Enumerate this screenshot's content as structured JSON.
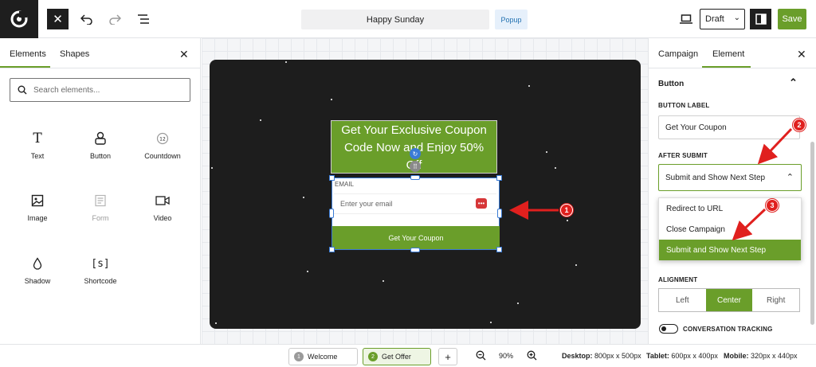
{
  "topbar": {
    "title": "Happy Sunday",
    "badge": "Popup",
    "status": "Draft",
    "save_label": "Save"
  },
  "left_panel": {
    "tabs": [
      "Elements",
      "Shapes"
    ],
    "search_placeholder": "Search elements...",
    "elements": [
      {
        "label": "Text",
        "icon": "text-icon"
      },
      {
        "label": "Button",
        "icon": "button-icon"
      },
      {
        "label": "Countdown",
        "icon": "countdown-icon"
      },
      {
        "label": "Image",
        "icon": "image-icon"
      },
      {
        "label": "Form",
        "icon": "form-icon",
        "disabled": true
      },
      {
        "label": "Video",
        "icon": "video-icon"
      },
      {
        "label": "Shadow",
        "icon": "shadow-icon"
      },
      {
        "label": "Shortcode",
        "icon": "shortcode-icon"
      }
    ]
  },
  "canvas": {
    "heading_line1": "Get Your Exclusive Coupon",
    "heading_line2": "Code Now and Enjoy 50%",
    "heading_line3": "Off",
    "email_label": "EMAIL",
    "email_placeholder": "Enter your email",
    "button_label": "Get Your Coupon"
  },
  "right_panel": {
    "tabs": [
      "Campaign",
      "Element"
    ],
    "section_title": "Button",
    "button_label_title": "BUTTON LABEL",
    "button_label_value": "Get Your Coupon",
    "after_submit_title": "AFTER SUBMIT",
    "after_submit_value": "Submit and Show Next Step",
    "dropdown_options": [
      "Redirect to URL",
      "Close Campaign",
      "Submit and Show Next Step"
    ],
    "dropdown_selected": 2,
    "alignment_title": "ALIGNMENT",
    "alignment_options": [
      "Left",
      "Center",
      "Right"
    ],
    "alignment_selected": "Center",
    "conversion_label": "CONVERSATION TRACKING"
  },
  "bottombar": {
    "steps": [
      {
        "num": "1",
        "label": "Welcome"
      },
      {
        "num": "2",
        "label": "Get Offer"
      }
    ],
    "zoom": "90%",
    "desktop_label": "Desktop:",
    "desktop_size": "800px x 500px",
    "tablet_label": "Tablet:",
    "tablet_size": "600px x 400px",
    "mobile_label": "Mobile:",
    "mobile_size": "320px x 440px"
  },
  "annotations": [
    "1",
    "2",
    "3"
  ],
  "colors": {
    "accent": "#6a9e2a",
    "selection": "#3a7bd5",
    "annotation": "#e0201e",
    "dark": "#1e1e1e"
  }
}
